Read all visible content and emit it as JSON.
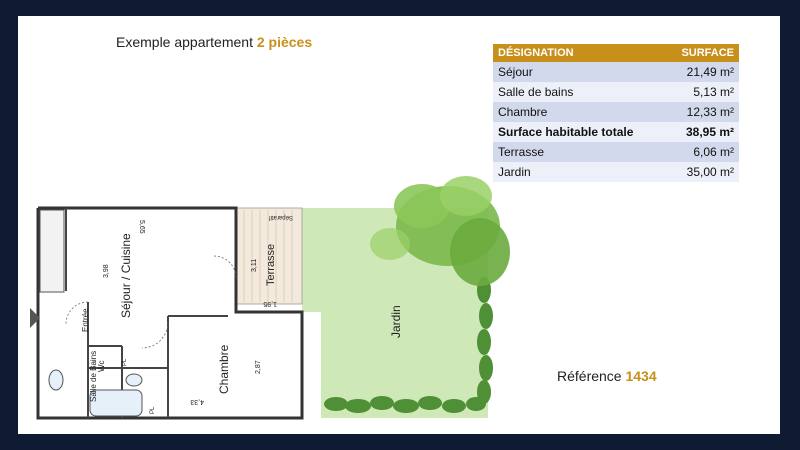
{
  "header": {
    "title_prefix": "Exemple appartement",
    "title_highlight": "2 pièces"
  },
  "colors": {
    "accent": "#c8901a",
    "frame": "#0f1a33",
    "row_band": "#d3d9ec",
    "row_plain": "#edf0f8",
    "garden": "#bfe0a0"
  },
  "table": {
    "col_designation": "DÉSIGNATION",
    "col_surface": "SURFACE",
    "rows": [
      {
        "label": "Séjour",
        "value": "21,49 m²"
      },
      {
        "label": "Salle de bains",
        "value": "5,13 m²"
      },
      {
        "label": "Chambre",
        "value": "12,33 m²"
      },
      {
        "label": "Surface habitable totale",
        "value": "38,95 m²"
      },
      {
        "label": "Terrasse",
        "value": "6,06 m²"
      },
      {
        "label": "Jardin",
        "value": "35,00 m²"
      }
    ]
  },
  "plan": {
    "sejour_label": "Séjour / Cuisine",
    "chambre_label": "Chambre",
    "terrasse_label": "Terrasse",
    "jardin_label": "Jardin",
    "entree_label": "Entrée",
    "sdb_label": "Salle de Bains",
    "wc_label": "Wc",
    "separatif_label": "Séparatif",
    "pl_label": "PL",
    "dim_398": "3,98",
    "dim_565": "5,65",
    "dim_311": "3,11",
    "dim_195": "1,95",
    "dim_287": "2,87",
    "dim_433": "4,33"
  },
  "reference": {
    "label": "Référence",
    "number": "1434"
  }
}
